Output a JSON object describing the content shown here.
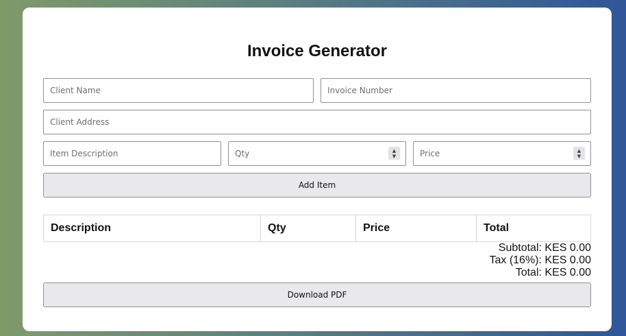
{
  "form": {
    "title": "Invoice Generator",
    "client_name_placeholder": "Client Name",
    "invoice_number_placeholder": "Invoice Number",
    "client_address_placeholder": "Client Address",
    "item_description_placeholder": "Item Description",
    "qty_placeholder": "Qty",
    "price_placeholder": "Price",
    "add_item_label": "Add Item"
  },
  "table": {
    "headers": [
      "Description",
      "Qty",
      "Price",
      "Total"
    ],
    "rows": []
  },
  "summary": {
    "subtotal": "Subtotal: KES 0.00",
    "tax": "Tax (16%): KES 0.00",
    "total": "Total: KES 0.00"
  },
  "actions": {
    "download_label": "Download PDF"
  },
  "icons": {
    "spinner": "up-down-arrows-icon"
  }
}
